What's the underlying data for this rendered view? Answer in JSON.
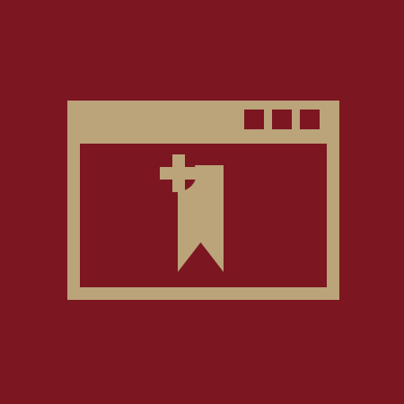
{
  "colors": {
    "background": "#7c1620",
    "icon": "#bba37a"
  },
  "icon": {
    "name": "browser-window-add-bookmark-icon"
  }
}
